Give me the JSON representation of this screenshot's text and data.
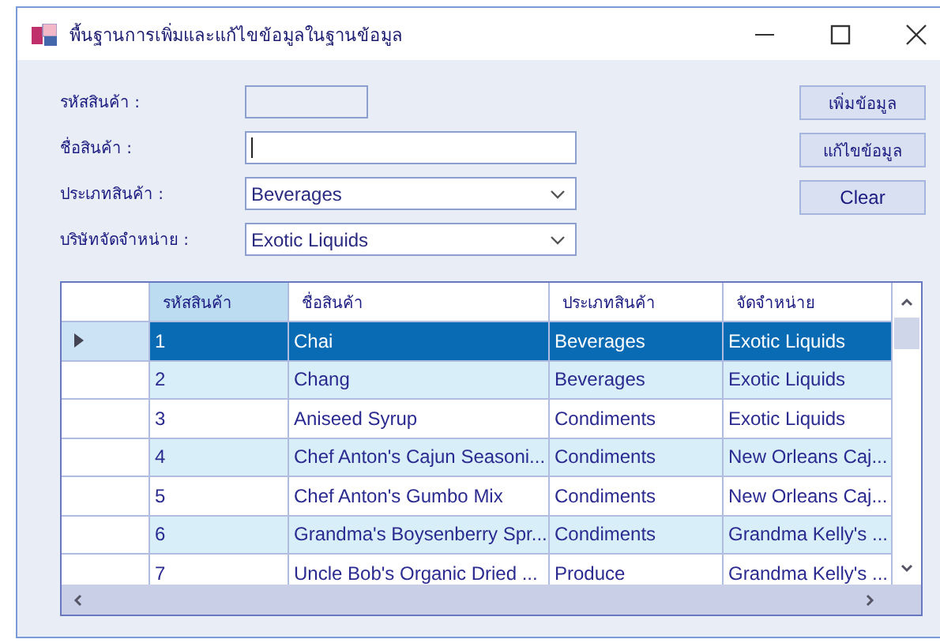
{
  "window": {
    "title": "พื้นฐานการเพิ่มและแก้ไขข้อมูลในฐานข้อมูล"
  },
  "form": {
    "fields": [
      {
        "kind": "readonly",
        "label": "รหัสสินค้า :"
      },
      {
        "kind": "text",
        "label": "ชื่อสินค้า :",
        "focused": true
      },
      {
        "kind": "combo",
        "label": "ประเภทสินค้า :",
        "value": "Beverages"
      },
      {
        "kind": "combo",
        "label": "บริษัทจัดจำหน่าย :",
        "value": "Exotic Liquids"
      }
    ]
  },
  "buttons": [
    "เพิ่มข้อมูล",
    "แก้ไขข้อมูล",
    "Clear"
  ],
  "table": {
    "columns": [
      "รหัสสินค้า",
      "ชื่อสินค้า",
      "ประเภทสินค้า",
      "จัดจำหน่าย"
    ],
    "rows": [
      {
        "selected": true,
        "cells": [
          "1",
          "Chai",
          "Beverages",
          "Exotic Liquids"
        ]
      },
      {
        "selected": false,
        "cells": [
          "2",
          "Chang",
          "Beverages",
          "Exotic Liquids"
        ]
      },
      {
        "selected": false,
        "cells": [
          "3",
          "Aniseed Syrup",
          "Condiments",
          "Exotic Liquids"
        ]
      },
      {
        "selected": false,
        "cells": [
          "4",
          "Chef Anton's Cajun Seasoni...",
          "Condiments",
          "New Orleans Caj..."
        ]
      },
      {
        "selected": false,
        "cells": [
          "5",
          "Chef Anton's Gumbo Mix",
          "Condiments",
          "New Orleans Caj..."
        ]
      },
      {
        "selected": false,
        "cells": [
          "6",
          "Grandma's Boysenberry Spr...",
          "Condiments",
          "Grandma Kelly's ..."
        ]
      },
      {
        "selected": false,
        "cells": [
          "7",
          "Uncle Bob's Organic Dried ...",
          "Produce",
          "Grandma Kelly's ..."
        ]
      }
    ]
  }
}
